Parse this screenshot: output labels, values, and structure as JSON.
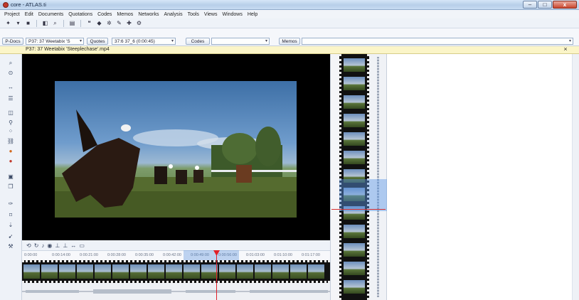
{
  "window": {
    "title": "core - ATLAS.ti",
    "minimize_label": "–",
    "maximize_label": "□",
    "close_label": "x"
  },
  "menu": {
    "items": [
      "Project",
      "Edit",
      "Documents",
      "Quotations",
      "Codes",
      "Memos",
      "Networks",
      "Analysis",
      "Tools",
      "Views",
      "Windows",
      "Help"
    ]
  },
  "toolbar2": {
    "pdocs_button": "P-Docs",
    "document_select": "P37: 37 Weetabix 'S",
    "quotes_button": "Quotes",
    "quote_select": "37:6 37_6 (0:00:45)",
    "codes_button": "Codes",
    "memos_button": "Memos"
  },
  "document_tab": {
    "label": "P37: 37 Weetabix 'Steeplechase'.mp4",
    "close_label": "×"
  },
  "media_controls": {
    "icons": [
      "rewind-icon",
      "loop-icon",
      "volume-icon",
      "snapshot-icon",
      "mark-start-icon",
      "mark-end-icon",
      "zoom-icon",
      "filmstrip-icon"
    ]
  },
  "timeline": {
    "tick_labels": [
      "0:00:00",
      "0:00:14:00",
      "0:00:21:00",
      "0:00:28:00",
      "0:00:35:00",
      "0:00:42:00",
      "0:00:49:00",
      "0:00:56:00",
      "0:01:03:00",
      "0:01:10:00",
      "0:01:17:00"
    ]
  },
  "colors": {
    "accent": "#5a96e6",
    "playhead": "#e0202a",
    "document_tab_bg": "#fbf5c8"
  }
}
